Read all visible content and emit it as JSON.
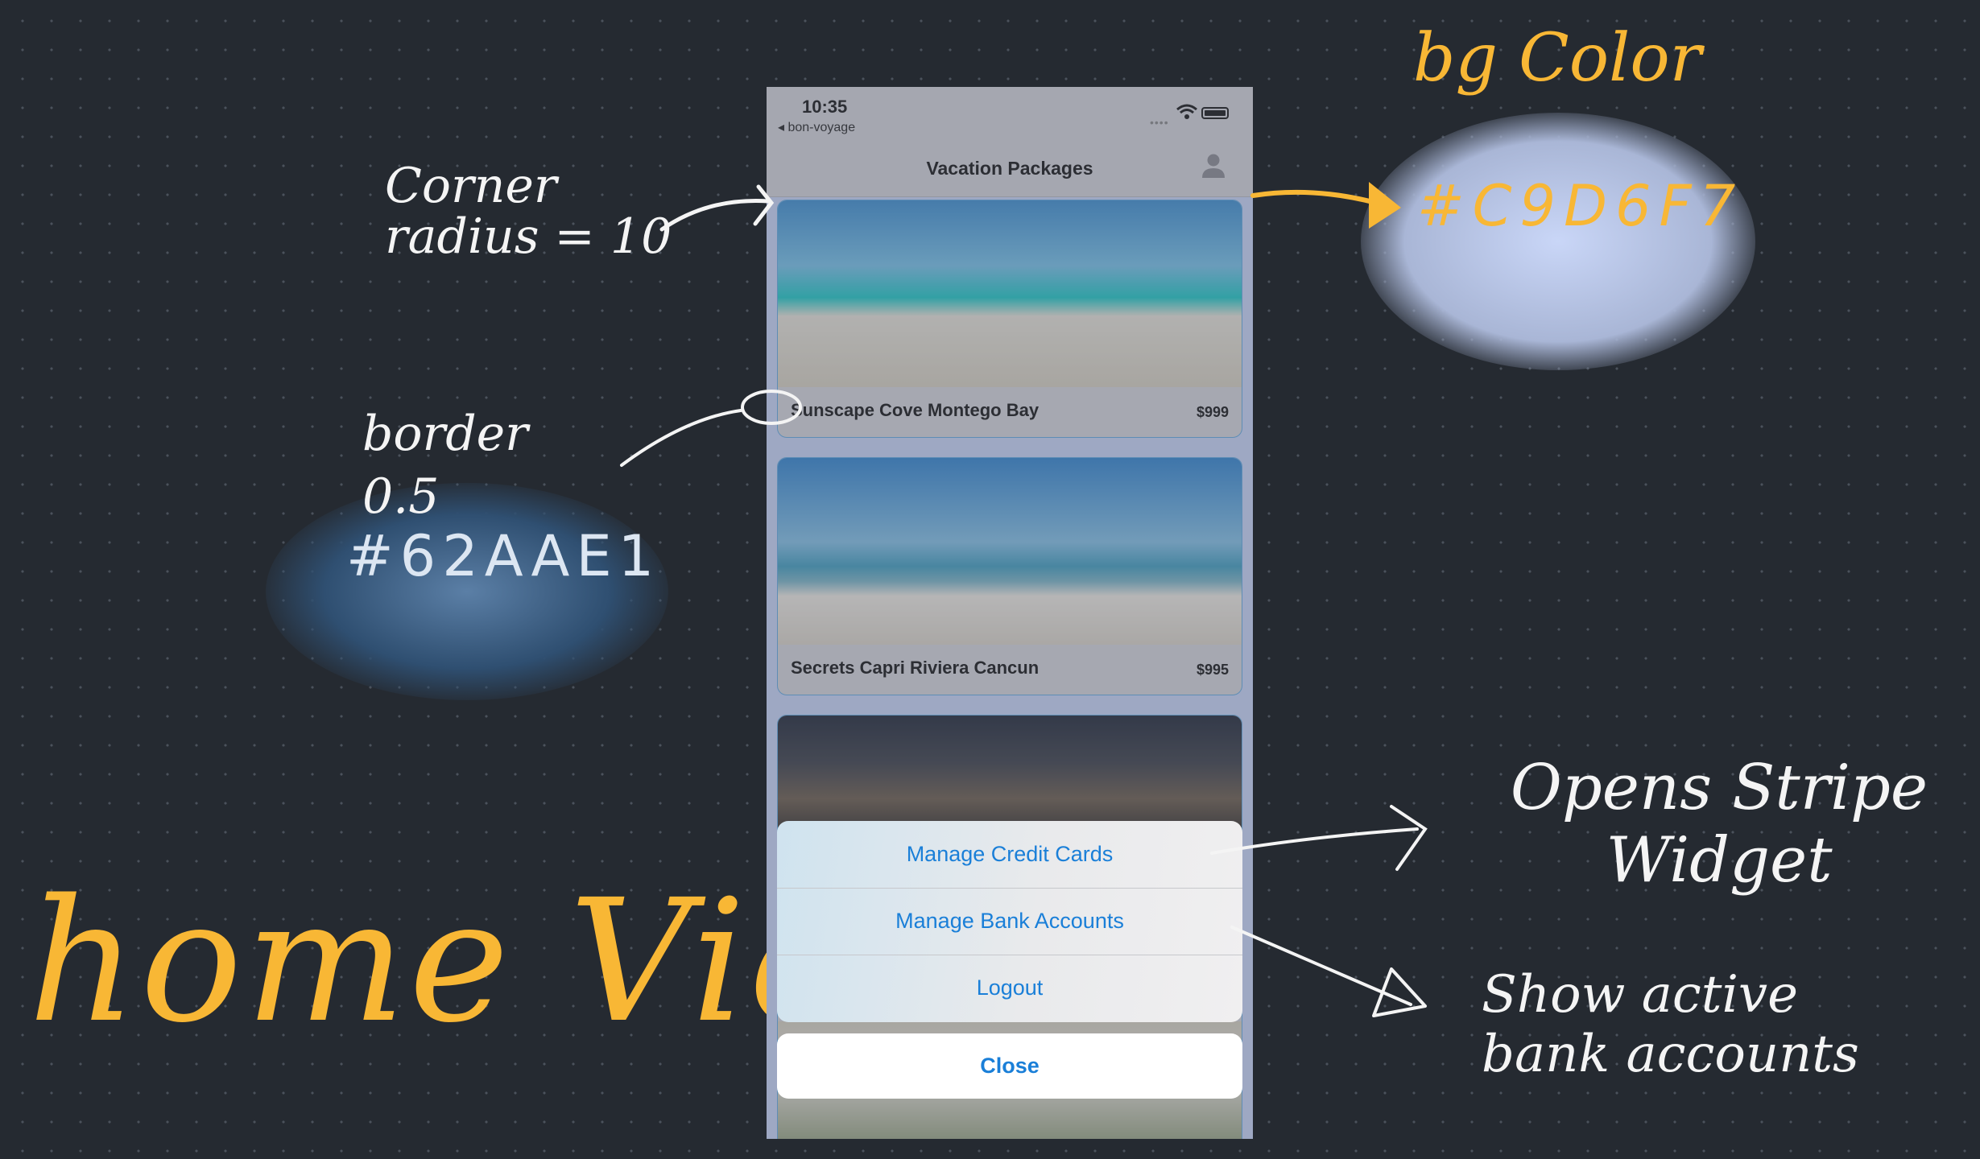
{
  "annotations": {
    "title": "home View",
    "bg_color_label": "bg Color",
    "bg_color_hex": "#C9D6F7",
    "corner_radius_note": "Corner radius = 10",
    "border_note": "border 0.5",
    "border_hex": "#62AAE1",
    "stripe_note": "Opens Stripe Widget",
    "bank_note": "Show active bank accounts"
  },
  "status_bar": {
    "time": "10:35",
    "back_app": "◂ bon-voyage",
    "signal": "••••"
  },
  "nav": {
    "title": "Vacation Packages",
    "profile_icon": "person-icon"
  },
  "packages": [
    {
      "name": "Sunscape Cove Montego Bay",
      "price": "$999"
    },
    {
      "name": "Secrets Capri Riviera Cancun",
      "price": "$995"
    }
  ],
  "action_sheet": {
    "manage_credit_cards": "Manage Credit Cards",
    "manage_bank_accounts": "Manage Bank Accounts",
    "logout": "Logout",
    "close": "Close"
  },
  "colors": {
    "background": "#C9D6F7",
    "card_border": "#62AAE1",
    "action_text": "#1A7FD8",
    "annotation_yellow": "#F8B735"
  }
}
